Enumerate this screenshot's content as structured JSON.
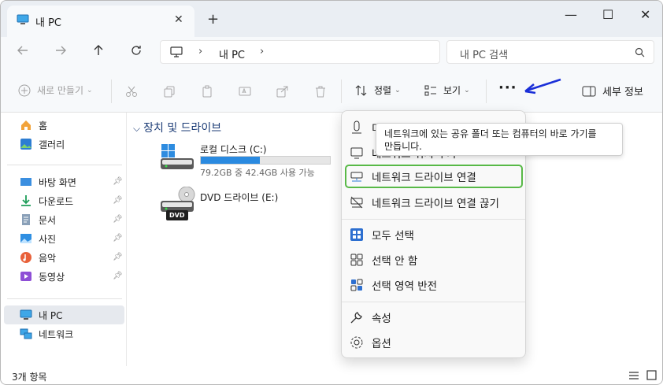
{
  "tab": {
    "title": "내 PC",
    "close": "✕",
    "new": "+"
  },
  "window": {
    "minimize": "—",
    "maximize": "☐",
    "close": "✕"
  },
  "address": {
    "crumb": "내 PC"
  },
  "search": {
    "placeholder": "내 PC 검색"
  },
  "toolbar": {
    "new": "새로 만들기",
    "sort": "정렬",
    "view": "보기",
    "more": "···",
    "details": "세부 정보"
  },
  "sidebar": {
    "items": [
      {
        "label": "홈",
        "icon": "home-icon"
      },
      {
        "label": "갤러리",
        "icon": "gallery-icon"
      },
      {
        "label": "바탕 화면",
        "icon": "desktop-icon",
        "pinned": true
      },
      {
        "label": "다운로드",
        "icon": "download-icon",
        "pinned": true
      },
      {
        "label": "문서",
        "icon": "document-icon",
        "pinned": true
      },
      {
        "label": "사진",
        "icon": "pictures-icon",
        "pinned": true
      },
      {
        "label": "음악",
        "icon": "music-icon",
        "pinned": true
      },
      {
        "label": "동영상",
        "icon": "video-icon",
        "pinned": true
      },
      {
        "label": "내 PC",
        "icon": "pc-icon",
        "selected": true
      },
      {
        "label": "네트워크",
        "icon": "network-icon"
      }
    ]
  },
  "content": {
    "section": "장치 및 드라이브",
    "drives": [
      {
        "name": "로컬 디스크 (C:)",
        "free_text": "79.2GB 중 42.4GB 사용 가능",
        "used_fraction": 0.46
      },
      {
        "name": "DVD 드라이브 (E:)",
        "badge": "DVD"
      }
    ]
  },
  "menu": {
    "items": [
      {
        "label": "미디어 서버에 연결",
        "icon": "media-icon"
      },
      {
        "label": "네트워크 위치 추가",
        "icon": "monitor-icon"
      },
      {
        "label": "네트워크 드라이브 연결",
        "icon": "map-drive-icon",
        "highlighted": true
      },
      {
        "label": "네트워크 드라이브 연결 끊기",
        "icon": "disconnect-drive-icon"
      },
      {
        "label": "모두 선택",
        "icon": "select-all-icon"
      },
      {
        "label": "선택 안 함",
        "icon": "select-none-icon"
      },
      {
        "label": "선택 영역 반전",
        "icon": "invert-selection-icon"
      },
      {
        "label": "속성",
        "icon": "properties-icon"
      },
      {
        "label": "옵션",
        "icon": "options-icon"
      }
    ]
  },
  "tooltip": {
    "line1": "네트워크에 있는 공유 폴더 또는 컴퓨터의 바로 가기를",
    "line2": "만듭니다."
  },
  "status": {
    "count": "3개 항목"
  },
  "colors": {
    "accent": "#2a8ae0",
    "highlight": "#58b947",
    "arrow": "#1a2fd8"
  }
}
